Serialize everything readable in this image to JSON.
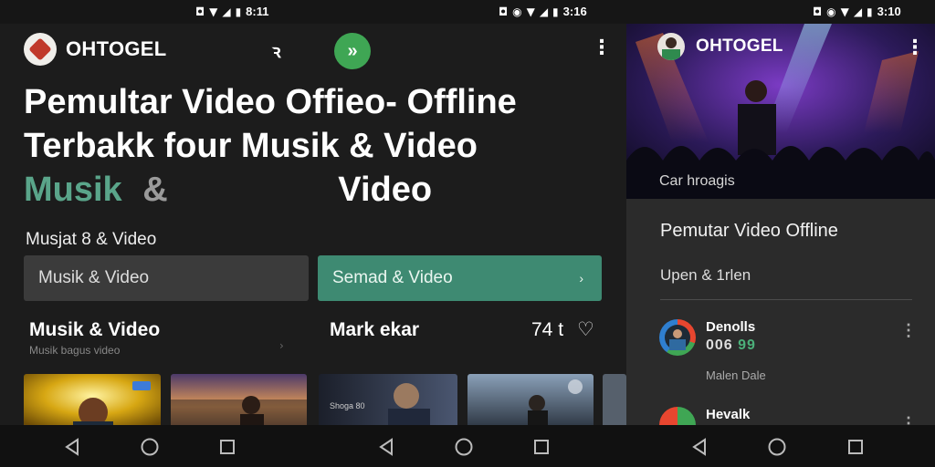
{
  "status_bar": {
    "times": [
      "8:11",
      "3:16",
      "3:10"
    ]
  },
  "app": {
    "name_left": "OHTOGEL",
    "name_right": "OHTOGEL"
  },
  "headline": {
    "line1": "Pemultar Video Offieo- Offline",
    "line2": "Terbakk four Musik & Video",
    "line3_word1": "Musik",
    "line3_amp": "&",
    "line3_word2": "Video"
  },
  "section_label": "Musjat 8 & Video",
  "fields": {
    "left": "Musik & Video",
    "right": "Semad & Video",
    "right_chevron": "›"
  },
  "row": {
    "left_title": "Musik & Video",
    "left_subtitle": "Musik bagus video",
    "middle_title": "Mark ekar",
    "count": "74 t"
  },
  "thumbnail_caption": "Shoga 80",
  "right_panel": {
    "concert_caption": "Car hroagis",
    "title": "Pemutar Video Offline",
    "subtitle": "Upen & 1rlen",
    "list": [
      {
        "name": "Denolls",
        "count_prefix": "006",
        "count_highlight": "99",
        "meta": "Malen Dale"
      },
      {
        "name": "Hevalk",
        "count_prefix": "",
        "count_highlight": "",
        "meta": ""
      }
    ]
  },
  "colors": {
    "accent_green": "#3e8a72",
    "fab_green": "#3fa654",
    "headline_green": "#5aa58a"
  },
  "icons": [
    "search-icon",
    "fast-forward-icon",
    "more-vert-icon",
    "heart-icon",
    "back-icon",
    "home-icon",
    "recents-icon"
  ]
}
